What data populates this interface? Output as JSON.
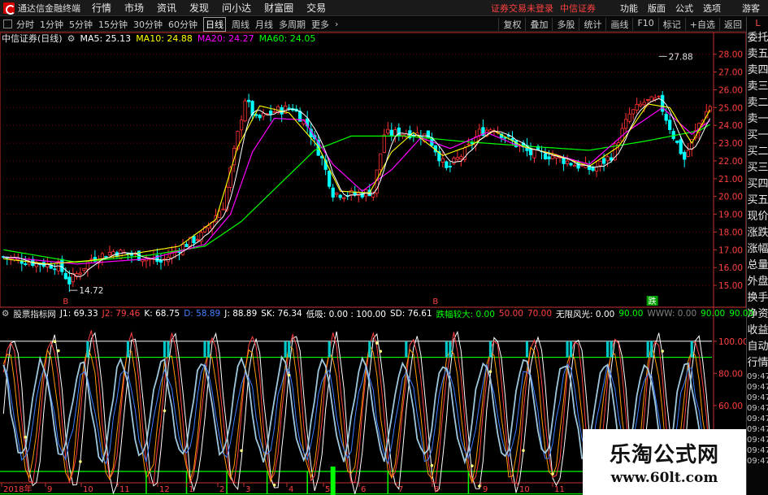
{
  "menubar": {
    "app_name": "通达信金融终端",
    "items": [
      "行情",
      "市场",
      "资讯",
      "发现",
      "问小达",
      "财富圈",
      "交易"
    ],
    "notice": "证券交易未登录",
    "broker": "中信证券",
    "right_items": [
      "功能",
      "版面",
      "公式",
      "选项"
    ],
    "guest": "游客"
  },
  "toolbar": {
    "periods": [
      "分时",
      "1分钟",
      "5分钟",
      "15分钟",
      "30分钟",
      "60分钟",
      "日线",
      "周线",
      "月线",
      "多周期",
      "更多"
    ],
    "active_period": "日线",
    "right_buttons": [
      "复权",
      "叠加",
      "多股",
      "统计",
      "画线",
      "F10",
      "标记",
      "+自选",
      "返回"
    ]
  },
  "side_panel": {
    "header": "L",
    "labels": [
      "委托",
      "卖五",
      "卖四",
      "卖三",
      "卖二",
      "卖一",
      "买一",
      "买二",
      "买三",
      "买四",
      "买五",
      "现价",
      "涨跌",
      "涨幅",
      "总量",
      "外盘",
      "换手",
      "净资",
      "收益"
    ],
    "mid_label": "自动",
    "mid_label2": "行情",
    "times": [
      "09:47",
      "09:47",
      "09:47",
      "09:47",
      "09:47",
      "09:47",
      "09:47",
      "09:47",
      "09:47"
    ]
  },
  "main_legend": {
    "title": "中信证券(日线)",
    "items": [
      {
        "label": "MA5: 25.13",
        "color": "#ffffff"
      },
      {
        "label": "MA10: 24.88",
        "color": "#ffff00"
      },
      {
        "label": "MA20: 24.27",
        "color": "#ff00ff"
      },
      {
        "label": "MA60: 24.05",
        "color": "#00ff00"
      }
    ]
  },
  "ind_legend": {
    "title": "股票指标网",
    "items": [
      {
        "label": "J1: 69.33",
        "color": "#ffffff"
      },
      {
        "label": "J2: 79.46",
        "color": "#ff4040"
      },
      {
        "label": "K: 68.75",
        "color": "#ffffff"
      },
      {
        "label": "D: 58.89",
        "color": "#4080ff"
      },
      {
        "label": "J: 88.89",
        "color": "#ffffff"
      },
      {
        "label": "SK: 76.34",
        "color": "#ffffff"
      },
      {
        "label": "低吸: 0.00 : 100.00",
        "color": "#ffffff"
      },
      {
        "label": "SD: 76.61",
        "color": "#ffffff"
      },
      {
        "label": "跌幅较大: 0.00",
        "color": "#00ff00"
      },
      {
        "label": "50.00",
        "color": "#ff4040"
      },
      {
        "label": "70.00",
        "color": "#ff4040"
      },
      {
        "label": "无限风光: 0.00",
        "color": "#ffffff"
      },
      {
        "label": "90.00",
        "color": "#00ff00"
      },
      {
        "label": "WWW: 0.00",
        "color": "#808080"
      },
      {
        "label": "90.00",
        "color": "#00ff00"
      },
      {
        "label": "90.00",
        "color": "#00ff00"
      }
    ]
  },
  "colors": {
    "up": "#ff3232",
    "down": "#00ffff",
    "ma5": "#ffffff",
    "ma10": "#ffff00",
    "ma20": "#ff00ff",
    "ma60": "#00ff00",
    "grid": "#7a0000",
    "axis": "#c83232"
  },
  "watermark": {
    "line1": "乐淘公式网",
    "line2": "www.60lt.com"
  },
  "markers": {
    "buy": "B",
    "sell": "跌"
  },
  "chart_data": [
    {
      "type": "candlestick",
      "title": "中信证券(日线)",
      "ylim": [
        14.5,
        28.4
      ],
      "y_ticks": [
        "28.00",
        "27.00",
        "26.00",
        "25.00",
        "24.00",
        "23.00",
        "22.00",
        "21.00",
        "20.00",
        "19.00",
        "18.00",
        "17.00",
        "16.00",
        "15.00"
      ],
      "annotations": [
        {
          "text": "27.88",
          "value": 27.88
        },
        {
          "text": "14.72",
          "value": 14.72
        }
      ],
      "close_path": [
        [
          0,
          16.6
        ],
        [
          8,
          16.3
        ],
        [
          15,
          16.1
        ],
        [
          18,
          15.2
        ],
        [
          24,
          16.5
        ],
        [
          30,
          16.9
        ],
        [
          38,
          16.6
        ],
        [
          43,
          16.3
        ],
        [
          48,
          17.1
        ],
        [
          54,
          17.8
        ],
        [
          60,
          19.5
        ],
        [
          63,
          22.5
        ],
        [
          66,
          25.5
        ],
        [
          69,
          24.3
        ],
        [
          74,
          24.8
        ],
        [
          79,
          25.0
        ],
        [
          83,
          24.0
        ],
        [
          87,
          22.1
        ],
        [
          90,
          20.2
        ],
        [
          96,
          20.1
        ],
        [
          101,
          20.3
        ],
        [
          104,
          23.5
        ],
        [
          110,
          23.6
        ],
        [
          116,
          23.4
        ],
        [
          121,
          21.5
        ],
        [
          126,
          22.5
        ],
        [
          130,
          23.6
        ],
        [
          134,
          23.9
        ],
        [
          138,
          23.2
        ],
        [
          144,
          22.4
        ],
        [
          150,
          22.3
        ],
        [
          156,
          21.8
        ],
        [
          161,
          21.5
        ],
        [
          166,
          22.3
        ],
        [
          171,
          24.6
        ],
        [
          175,
          25.3
        ],
        [
          179,
          25.4
        ],
        [
          183,
          23.4
        ],
        [
          186,
          22.1
        ],
        [
          190,
          24.1
        ],
        [
          193,
          25.1
        ]
      ],
      "ma60_path": [
        [
          0,
          17.0
        ],
        [
          20,
          16.3
        ],
        [
          40,
          16.7
        ],
        [
          55,
          17.2
        ],
        [
          65,
          18.6
        ],
        [
          75,
          20.6
        ],
        [
          85,
          22.6
        ],
        [
          95,
          23.4
        ],
        [
          110,
          23.4
        ],
        [
          125,
          23.1
        ],
        [
          145,
          22.8
        ],
        [
          160,
          22.6
        ],
        [
          175,
          23.1
        ],
        [
          190,
          23.7
        ],
        [
          193,
          24.05
        ]
      ],
      "ma20_path": [
        [
          0,
          16.6
        ],
        [
          20,
          16.2
        ],
        [
          40,
          16.5
        ],
        [
          55,
          17.3
        ],
        [
          62,
          19.0
        ],
        [
          68,
          22.5
        ],
        [
          74,
          24.4
        ],
        [
          82,
          24.3
        ],
        [
          90,
          21.8
        ],
        [
          98,
          20.3
        ],
        [
          106,
          21.5
        ],
        [
          114,
          23.3
        ],
        [
          122,
          22.7
        ],
        [
          132,
          23.6
        ],
        [
          140,
          22.9
        ],
        [
          150,
          22.4
        ],
        [
          160,
          21.8
        ],
        [
          170,
          23.6
        ],
        [
          180,
          25.0
        ],
        [
          188,
          23.5
        ],
        [
          193,
          24.27
        ]
      ],
      "ma10_path": [
        [
          0,
          16.5
        ],
        [
          12,
          16.2
        ],
        [
          24,
          16.4
        ],
        [
          36,
          16.8
        ],
        [
          48,
          17.2
        ],
        [
          58,
          18.7
        ],
        [
          64,
          22.8
        ],
        [
          70,
          25.1
        ],
        [
          78,
          24.7
        ],
        [
          86,
          22.8
        ],
        [
          92,
          20.3
        ],
        [
          100,
          20.2
        ],
        [
          106,
          22.5
        ],
        [
          112,
          23.6
        ],
        [
          120,
          22.3
        ],
        [
          128,
          22.9
        ],
        [
          134,
          23.7
        ],
        [
          142,
          22.8
        ],
        [
          150,
          22.4
        ],
        [
          160,
          21.7
        ],
        [
          168,
          22.8
        ],
        [
          176,
          25.2
        ],
        [
          182,
          25.0
        ],
        [
          188,
          23.0
        ],
        [
          193,
          24.88
        ]
      ],
      "markers": [
        {
          "text": "B",
          "index": 17
        },
        {
          "text": "B",
          "index": 118
        },
        {
          "text": "跌",
          "index": 177
        }
      ]
    },
    {
      "type": "line",
      "title": "股票指标网",
      "ylim": [
        20,
        110
      ],
      "y_ticks": [
        "100.00",
        "80.00",
        "60.00",
        "40.00"
      ],
      "h_lines": [
        {
          "value": 100,
          "color": "#c8c8c8"
        },
        {
          "value": 90,
          "color": "#00ff00"
        },
        {
          "value": 19,
          "color": "#00ff00"
        },
        {
          "value": 5,
          "color": "#00ff00"
        }
      ],
      "period": 11,
      "series": [
        {
          "name": "J1",
          "color": "#ffffff"
        },
        {
          "name": "J2",
          "color": "#ff4040"
        },
        {
          "name": "K",
          "color": "#ff9900"
        },
        {
          "name": "D",
          "color": "#4080ff"
        },
        {
          "name": "SD",
          "color": "#a0c8dc"
        }
      ]
    }
  ],
  "x_axis": {
    "labels": [
      "2018年",
      "9",
      "10",
      "11",
      "12",
      "1",
      "2",
      "3",
      "4",
      "5",
      "6",
      "7",
      "8",
      "9",
      "10",
      "11"
    ]
  }
}
